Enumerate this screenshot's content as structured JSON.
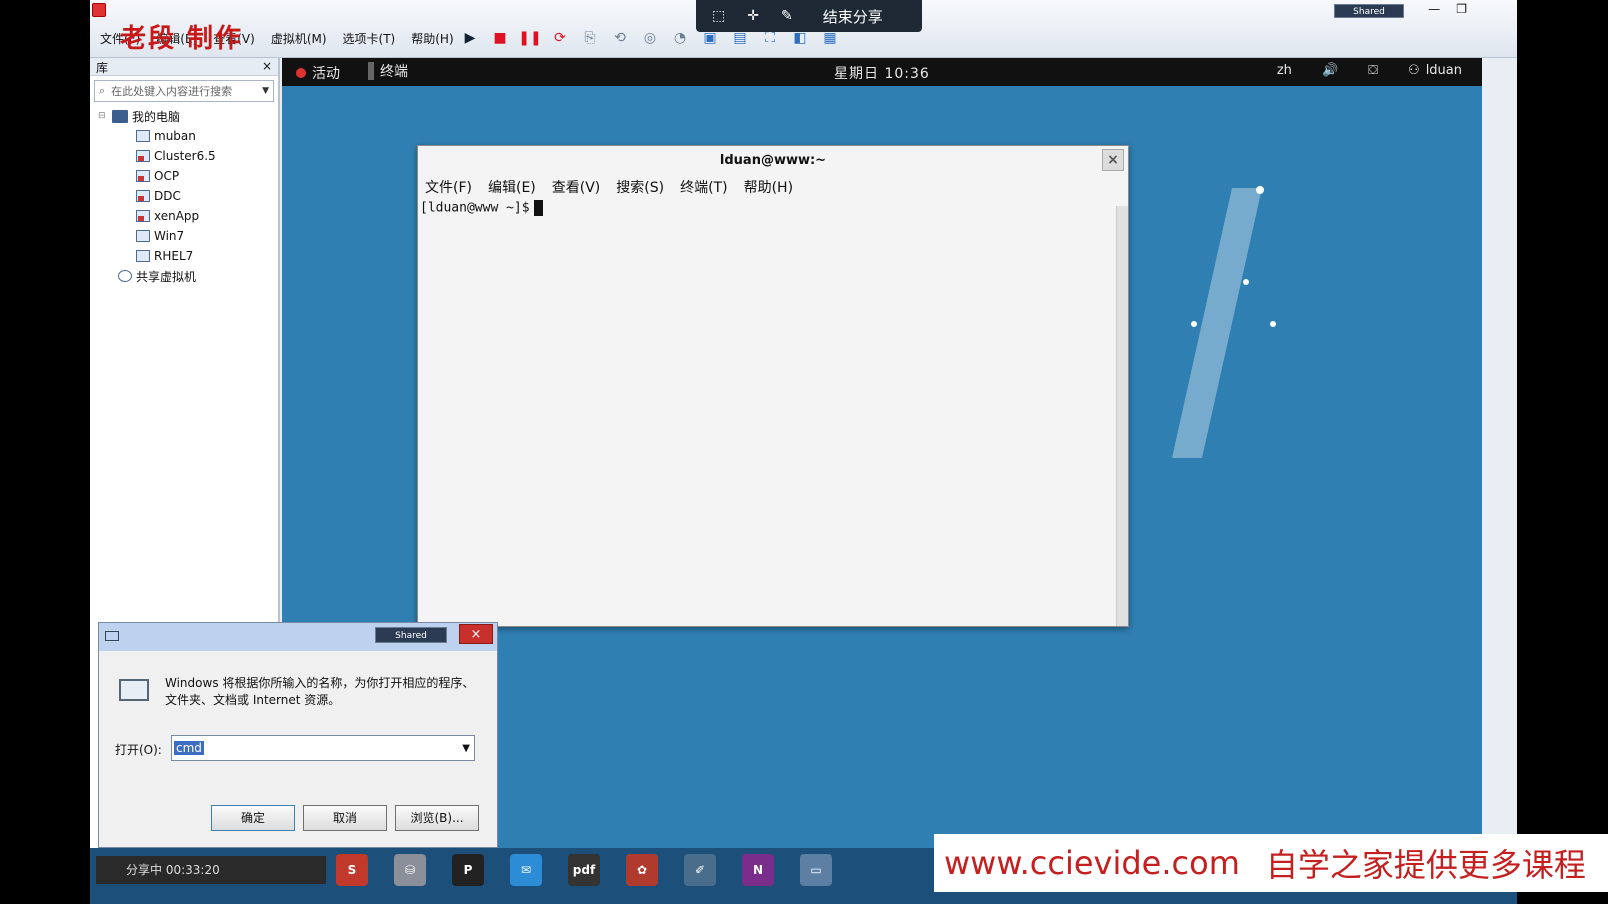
{
  "watermark_author": "老段 制作",
  "menu": [
    "文件(F)",
    "编辑(E)",
    "查看(V)",
    "虚拟机(M)",
    "选项卡(T)",
    "帮助(H)"
  ],
  "share_bar": {
    "end_label": "结束分享"
  },
  "shared_badge": "Shared",
  "library": {
    "title": "库",
    "close": "×",
    "search_placeholder": "在此处键入内容进行搜索",
    "root": "我的电脑",
    "vms": [
      "muban",
      "Cluster6.5",
      "OCP",
      "DDC",
      "xenApp",
      "Win7",
      "RHEL7"
    ],
    "shared_vms": "共享虚拟机"
  },
  "gnome": {
    "activities": "活动",
    "task": "终端",
    "clock": "星期日 10:36",
    "lang": "zh",
    "user": "lduan"
  },
  "terminal": {
    "title": "lduan@www:~",
    "close": "×",
    "menu": [
      "文件(F)",
      "编辑(E)",
      "查看(V)",
      "搜索(S)",
      "终端(T)",
      "帮助(H)"
    ],
    "prompt": "[lduan@www ~]$"
  },
  "run_dialog": {
    "shared": "Shared",
    "close": "×",
    "description": "Windows 将根据你所输入的名称，为你打开相应的程序、文件夹、文档或 Internet 资源。",
    "open_label": "打开(O):",
    "input_value": "cmd",
    "ok": "确定",
    "cancel": "取消",
    "browse": "浏览(B)..."
  },
  "taskbar": {
    "share_status": "分享中 00:33:20",
    "pdf_label": "pdf"
  },
  "banner": {
    "site": "www.ccievide.com",
    "slogan": "自学之家提供更多课程"
  }
}
